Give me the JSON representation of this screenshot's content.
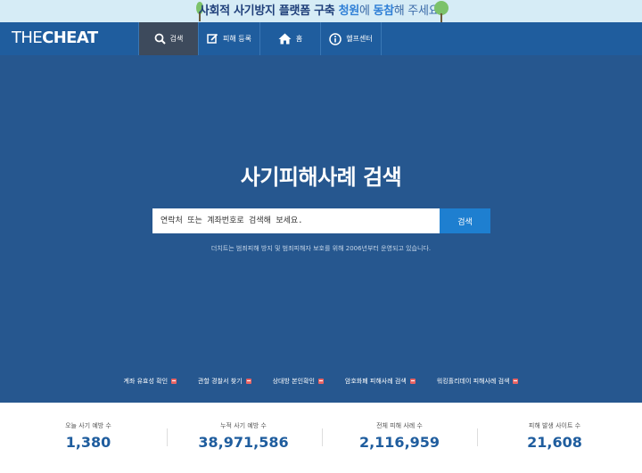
{
  "banner": {
    "part1": "사회적 사기방지 플랫폼 구축 ",
    "part2": "청원",
    "part3": "에 ",
    "part4": "동참",
    "part5": "해 주세요!"
  },
  "logo": {
    "part1": "THE",
    "part2": "CHEAT"
  },
  "nav": {
    "search": "검색",
    "report": "피해 등록",
    "home": "홈",
    "help": "헬프센터"
  },
  "hero": {
    "title": "사기피해사례 검색",
    "search_placeholder": "연락처 또는 계좌번호로 검색해 보세요.",
    "search_button": "검색",
    "description": "더치트는 범죄피해 방지 및 범죄피해자 보호를 위해 2006년부터 운영되고 있습니다."
  },
  "quick_links": [
    "계좌 유효성 확인",
    "관할 경찰서 찾기",
    "상대방 본인확인",
    "암호화폐 피해사례 검색",
    "워킹홀리데이 피해사례 검색"
  ],
  "stats": [
    {
      "label": "오늘 사기 예방 수",
      "value": "1,380"
    },
    {
      "label": "누적 사기 예방 수",
      "value": "38,971,586"
    },
    {
      "label": "전체 피해 사례 수",
      "value": "2,116,959"
    },
    {
      "label": "피해 발생 사이트 수",
      "value": "21,608"
    }
  ],
  "colors": {
    "nav_bg": "#1f5d9e",
    "hero_bg": "#26578f",
    "active_nav": "#3d4a5c",
    "search_button": "#1e7fd0",
    "banner_bg": "#d6ecf6",
    "stat_value": "#1f5d9e"
  },
  "icons": {
    "search": "search-icon",
    "report": "edit-icon",
    "home": "home-icon",
    "help": "info-icon"
  }
}
